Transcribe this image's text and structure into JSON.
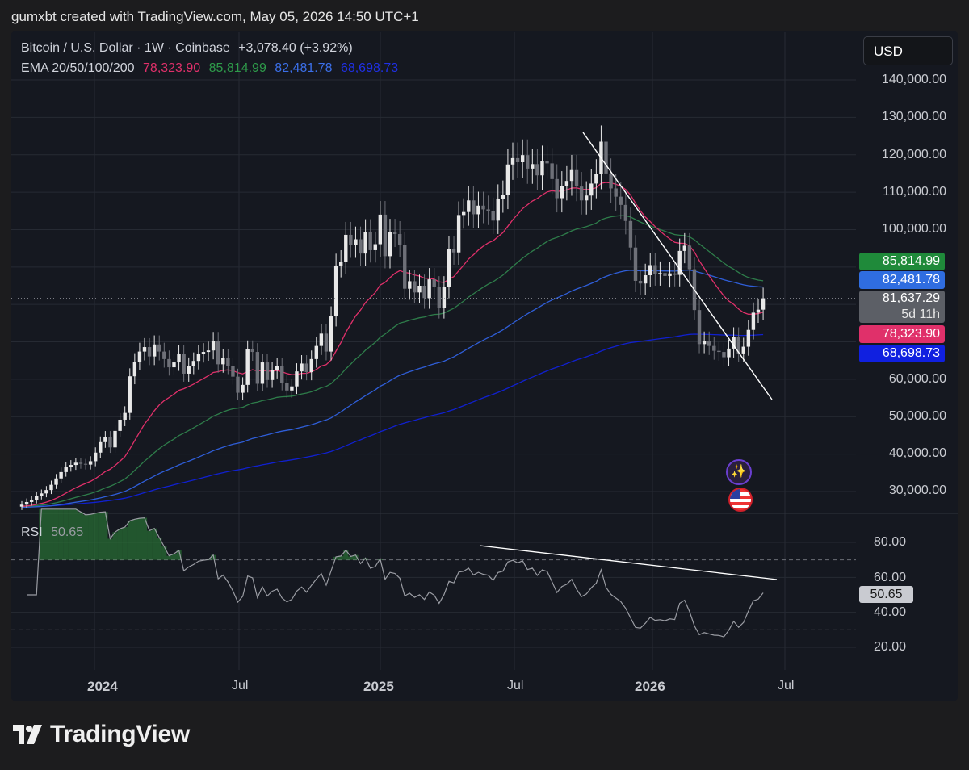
{
  "caption": "gumxbt created with TradingView.com, May 05, 2026 14:50 UTC+1",
  "brand": "TradingView",
  "legend": {
    "symbol": "Bitcoin / U.S. Dollar · 1W · Coinbase",
    "change": "+3,078.40 (+3.92%)",
    "ema_label": "EMA 20/50/100/200",
    "ema20": "78,323.90",
    "ema50": "85,814.99",
    "ema100": "82,481.78",
    "ema200": "68,698.73",
    "rsi_label": "RSI",
    "rsi_value": "50.65"
  },
  "currency_button": "USD",
  "colors": {
    "ema20": "#e0306a",
    "ema50": "#2e7d4a",
    "ema100": "#2f5ed8",
    "ema200": "#1020d0",
    "price_badge": "#5c5f66",
    "rsi_line": "#9a9ca3",
    "candle_up": "#e8e8e8",
    "candle_down": "#6e7078",
    "accent_green": "#2e8b3a"
  },
  "price_badges": {
    "ema50": "85,814.99",
    "ema100": "82,481.78",
    "last_price": "81,637.29",
    "countdown": "5d 11h",
    "ema20": "78,323.90",
    "ema200": "68,698.73"
  },
  "rsi_badge": "50.65",
  "chart_data": [
    {
      "type": "candlestick",
      "title": "Bitcoin / U.S. Dollar · 1W · Coinbase",
      "y_ticks": [
        "140,000.00",
        "130,000.00",
        "120,000.00",
        "110,000.00",
        "100,000.00",
        "60,000.00",
        "50,000.00",
        "40,000.00",
        "30,000.00"
      ],
      "x_ticks": [
        "2024",
        "Jul",
        "2025",
        "Jul",
        "2026",
        "Jul"
      ],
      "ylim": [
        25000,
        145000
      ],
      "last_price": 81637.29,
      "close": [
        26500,
        27200,
        27800,
        28900,
        29500,
        30400,
        31800,
        33500,
        35200,
        36600,
        37100,
        37700,
        37400,
        37200,
        38100,
        40400,
        43200,
        44600,
        41800,
        46200,
        49200,
        51000,
        60800,
        64700,
        67400,
        68600,
        66100,
        69300,
        67400,
        65400,
        63200,
        64500,
        66800,
        61500,
        63600,
        64900,
        66800,
        67300,
        67700,
        70200,
        64000,
        65700,
        63600,
        60700,
        56400,
        58500,
        68000,
        67300,
        58800,
        64500,
        59800,
        62400,
        63500,
        59100,
        57000,
        58100,
        62100,
        64200,
        61900,
        65400,
        68900,
        72200,
        67400,
        76800,
        90400,
        91300,
        98600,
        95800,
        97400,
        93600,
        99300,
        94500,
        96100,
        104000,
        92900,
        99400,
        98800,
        96000,
        84200,
        86200,
        83200,
        85000,
        81700,
        86700,
        84600,
        79000,
        84600,
        94900,
        93900,
        103900,
        104700,
        107800,
        104100,
        106400,
        105400,
        104900,
        102400,
        108300,
        109300,
        117400,
        119100,
        118000,
        119900,
        116300,
        117500,
        114500,
        118300,
        117700,
        113500,
        108400,
        111700,
        113000,
        115900,
        111500,
        107800,
        109100,
        112300,
        114800,
        123500,
        115000,
        111000,
        108800,
        106600,
        102300,
        95200,
        86300,
        85600,
        87800,
        90500,
        88100,
        88400,
        87600,
        88300,
        87900,
        94300,
        95700,
        89400,
        78500,
        69400,
        70300,
        68900,
        67600,
        67300,
        65900,
        68200,
        71400,
        66900,
        68700,
        73200,
        77800,
        78600,
        81637.29
      ],
      "ema20_last": 78323.9,
      "ema50_last": 85814.99,
      "ema100_last": 82481.78,
      "ema200_last": 68698.73
    },
    {
      "type": "line",
      "title": "RSI",
      "y_ticks": [
        "80.00",
        "60.00",
        "40.00",
        "20.00"
      ],
      "ylim": [
        10,
        90
      ],
      "bands": [
        70,
        30
      ],
      "last_value": 50.65
    }
  ]
}
